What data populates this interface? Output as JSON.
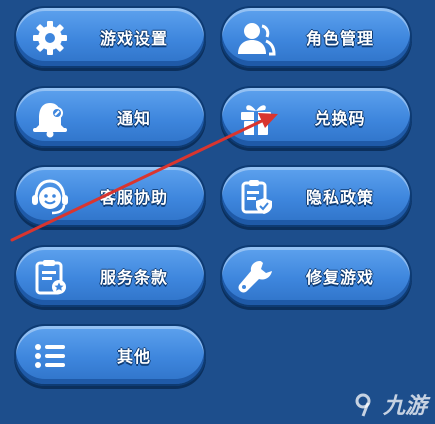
{
  "menu": {
    "items": [
      {
        "id": "game-settings",
        "label": "游戏设置",
        "icon": "gear-icon"
      },
      {
        "id": "role-management",
        "label": "角色管理",
        "icon": "user-icon"
      },
      {
        "id": "notifications",
        "label": "通知",
        "icon": "bell-icon"
      },
      {
        "id": "redeem-code",
        "label": "兑换码",
        "icon": "gift-icon"
      },
      {
        "id": "customer-service",
        "label": "客服协助",
        "icon": "headset-icon"
      },
      {
        "id": "privacy-policy",
        "label": "隐私政策",
        "icon": "shield-document-icon"
      },
      {
        "id": "terms-of-service",
        "label": "服务条款",
        "icon": "clipboard-star-icon"
      },
      {
        "id": "repair-game",
        "label": "修复游戏",
        "icon": "wrench-icon"
      },
      {
        "id": "other",
        "label": "其他",
        "icon": "list-icon"
      }
    ]
  },
  "annotation": {
    "color": "#d9352f"
  },
  "watermark": {
    "text": "九游",
    "icon": "9game-logo-icon"
  }
}
